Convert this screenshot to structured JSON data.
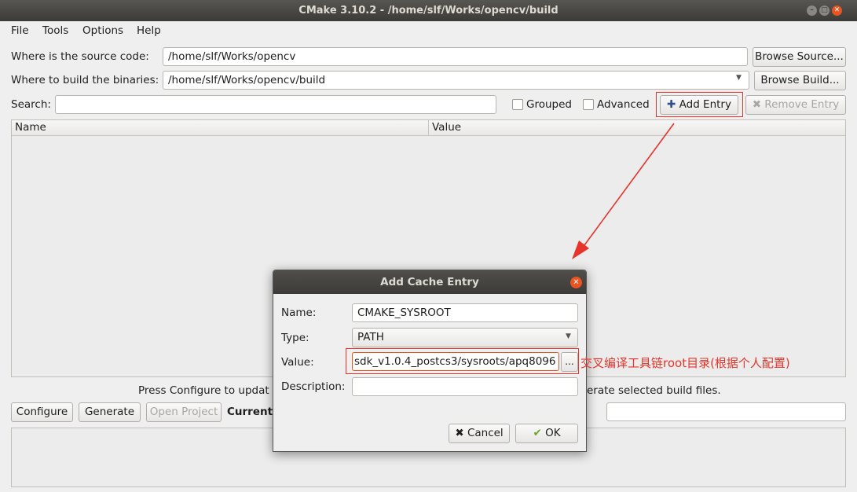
{
  "window": {
    "title": "CMake 3.10.2 - /home/slf/Works/opencv/build"
  },
  "menu": [
    "File",
    "Tools",
    "Options",
    "Help"
  ],
  "source": {
    "label": "Where is the source code:",
    "value": "/home/slf/Works/opencv",
    "browse": "Browse Source..."
  },
  "build": {
    "label": "Where to build the binaries:",
    "value": "/home/slf/Works/opencv/build",
    "browse": "Browse Build..."
  },
  "search": {
    "label": "Search:",
    "value": ""
  },
  "options": {
    "grouped": "Grouped",
    "advanced": "Advanced",
    "add_entry": "Add Entry",
    "remove_entry": "Remove Entry"
  },
  "table": {
    "columns": [
      "Name",
      "Value"
    ]
  },
  "status": {
    "left": "Press Configure to updat",
    "right": "erate selected build files."
  },
  "actions": {
    "configure": "Configure",
    "generate": "Generate",
    "open_project": "Open Project",
    "current": "Current "
  },
  "dialog": {
    "title": "Add Cache Entry",
    "name_label": "Name:",
    "name_value": "CMAKE_SYSROOT",
    "type_label": "Type:",
    "type_value": "PATH",
    "value_label": "Value:",
    "value_value": "sdk_v1.0.4_postcs3/sysroots/apq8096",
    "browse": "...",
    "description_label": "Description:",
    "description_value": "",
    "cancel": "Cancel",
    "ok": "OK"
  },
  "annotation": "交叉编译工具链root目录(根据个人配置)",
  "colors": {
    "accent": "#e95420",
    "annotation": "#e8332a"
  }
}
